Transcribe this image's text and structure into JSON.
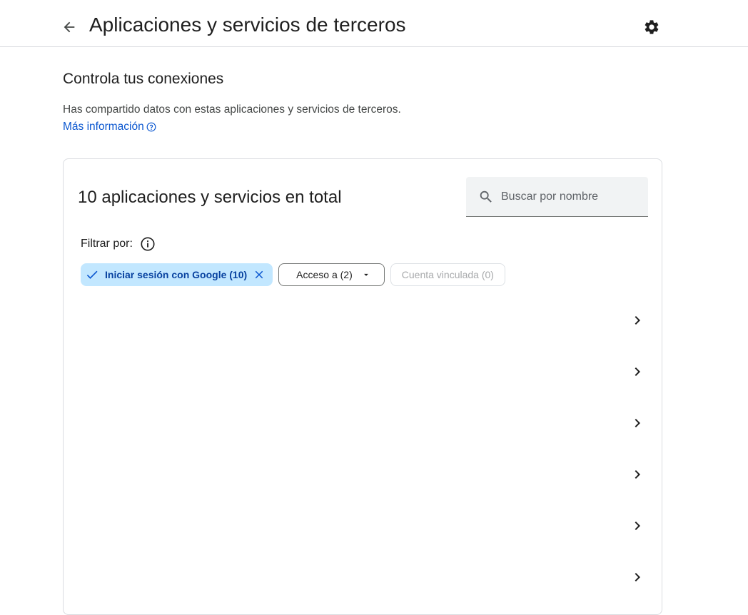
{
  "header": {
    "title": "Aplicaciones y servicios de terceros",
    "back_icon": "arrow-back-icon",
    "settings_icon": "gear-icon"
  },
  "intro": {
    "title": "Controla tus conexiones",
    "description": "Has compartido datos con estas aplicaciones y servicios de terceros.",
    "more_info": "Más información"
  },
  "card": {
    "title": "10 aplicaciones y servicios en total",
    "search": {
      "placeholder": "Buscar por nombre",
      "value": ""
    },
    "filter_label": "Filtrar por:",
    "chips": [
      {
        "label": "Iniciar sesión con Google (10)",
        "state": "selected"
      },
      {
        "label": "Acceso a (2)",
        "state": "dropdown"
      },
      {
        "label": "Cuenta vinculada (0)",
        "state": "disabled"
      }
    ],
    "rows": [
      {
        "icon": "chevron-right-icon"
      },
      {
        "icon": "chevron-right-icon"
      },
      {
        "icon": "chevron-right-icon"
      },
      {
        "icon": "chevron-right-icon"
      },
      {
        "icon": "chevron-right-icon"
      },
      {
        "icon": "chevron-right-icon"
      }
    ]
  },
  "colors": {
    "accent": "#0b57d0",
    "chip_selected_bg": "#c2e7ff",
    "border": "#dadce0"
  }
}
